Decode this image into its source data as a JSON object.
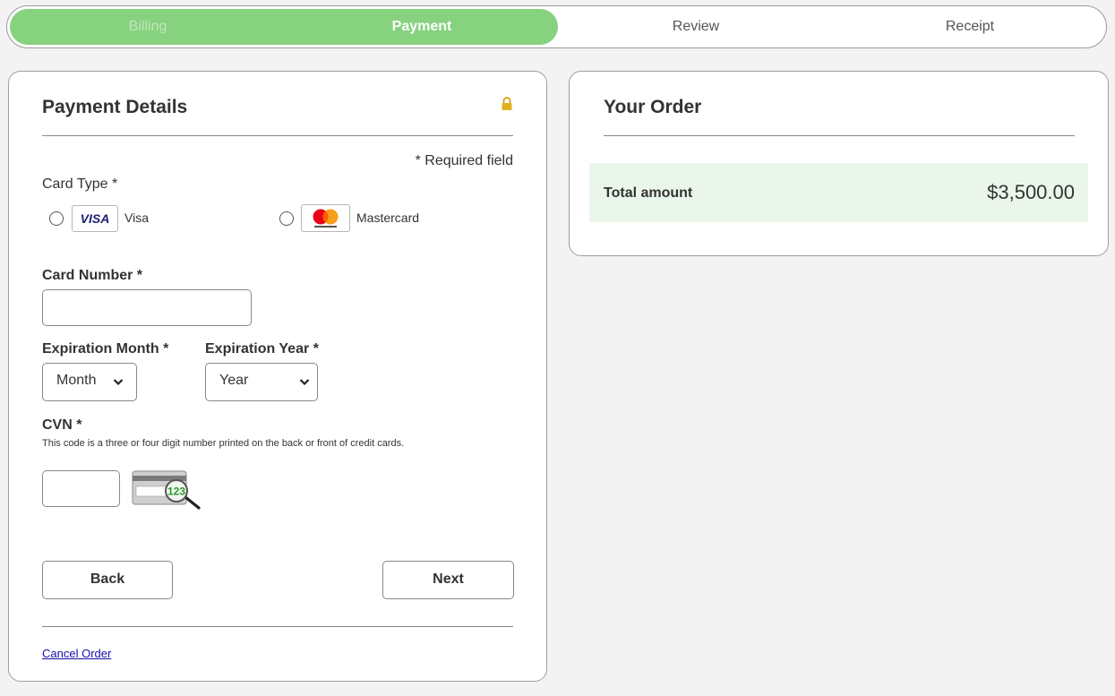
{
  "steps": [
    {
      "label": "Billing",
      "state": "done"
    },
    {
      "label": "Payment",
      "state": "current"
    },
    {
      "label": "Review",
      "state": "upcoming"
    },
    {
      "label": "Receipt",
      "state": "upcoming"
    }
  ],
  "payment": {
    "title": "Payment Details",
    "required_note": "* Required field",
    "card_type_label": "Card Type *",
    "card_options": [
      {
        "label": "Visa",
        "logo_text": "VISA"
      },
      {
        "label": "Mastercard"
      }
    ],
    "card_number_label": "Card Number *",
    "card_number_value": "",
    "exp_month_label": "Expiration Month *",
    "exp_month_value": "Month",
    "exp_year_label": "Expiration Year *",
    "exp_year_value": "Year",
    "cvn_label": "CVN *",
    "cvn_help": "This code is a three or four digit number printed on the back or front of credit cards.",
    "cvn_value": "",
    "back_label": "Back",
    "next_label": "Next",
    "cancel_label": "Cancel Order"
  },
  "order": {
    "title": "Your Order",
    "total_label": "Total amount",
    "total_value": "$3,500.00"
  },
  "colors": {
    "progress_fill": "#86d27f",
    "total_row_bg": "#eaf6e9",
    "link": "#1a0dab",
    "lock": "#d4a514"
  }
}
